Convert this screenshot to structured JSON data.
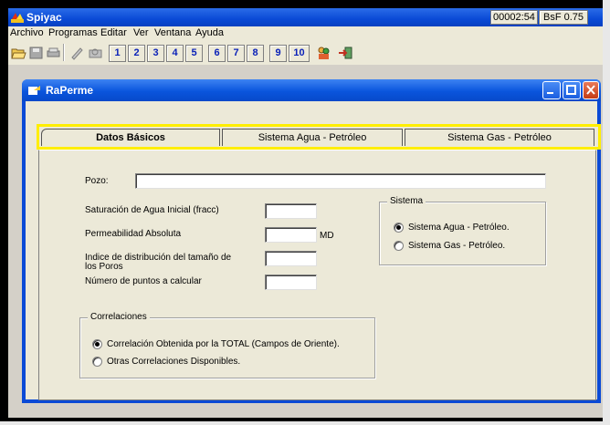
{
  "app": {
    "title": "Spiyac",
    "status_time": "00002:54",
    "status_price": "BsF 0.75"
  },
  "menu": [
    "Archivo",
    "Programas",
    "Editar",
    "Ver",
    "Ventana",
    "Ayuda"
  ],
  "toolbar": {
    "numbers": [
      "1",
      "2",
      "3",
      "4",
      "5",
      "6",
      "7",
      "8",
      "9",
      "10"
    ],
    "icons": [
      "open-folder-icon",
      "save-icon",
      "printer-icon",
      "pencil-icon",
      "print-preview-icon",
      "people-icon",
      "exit-door-icon"
    ]
  },
  "child_window": {
    "title": "RaPerme"
  },
  "tabs": [
    "Datos Básicos",
    "Sistema Agua - Petróleo",
    "Sistema Gas - Petróleo"
  ],
  "form": {
    "pozo_label": "Pozo:",
    "pozo_value": "",
    "saturacion_label": "Saturación de Agua Inicial  (fracc)",
    "saturacion_value": "",
    "permeabilidad_label": "Permeabilidad Absoluta",
    "permeabilidad_value": "",
    "permeabilidad_unit": "MD",
    "indice_label_line1": "Indice de distribución del tamaño de",
    "indice_label_line2": "los Poros",
    "indice_value": "",
    "puntos_label": "Número de puntos a calcular",
    "puntos_value": ""
  },
  "sistema": {
    "title": "Sistema",
    "options": [
      {
        "label": "Sistema Agua - Petróleo.",
        "checked": true
      },
      {
        "label": "Sistema Gas - Petróleo.",
        "checked": false
      }
    ]
  },
  "correlaciones": {
    "title": "Correlaciones",
    "options": [
      {
        "label": "Correlación Obtenida por la TOTAL (Campos de Oriente).",
        "checked": true
      },
      {
        "label": "Otras Correlaciones Disponibles.",
        "checked": false
      }
    ]
  }
}
